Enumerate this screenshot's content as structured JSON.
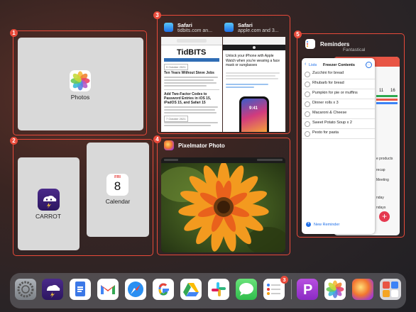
{
  "cards": {
    "photos": {
      "number": "1",
      "label": "Photos",
      "icon": "photos-icon"
    },
    "carrot_calendar": {
      "number": "2",
      "carrot_label": "CARROT",
      "calendar_label": "Calendar",
      "calendar_day": "FRI",
      "calendar_date": "8"
    },
    "safari": {
      "number": "3",
      "left": {
        "title": "Safari",
        "subtitle": "tidbits.com an..."
      },
      "right": {
        "title": "Safari",
        "subtitle": "apple.com and 3..."
      },
      "tidbits": {
        "site_name": "TidBITS",
        "date1": "9 October 2021",
        "headline1": "Ten Years Without Steve Jobs",
        "headline2": "Add Two-Factor Codes to Password Entries in iOS 15, iPadOS 15, and Safari 15",
        "date2": "7 October 2021"
      },
      "apple": {
        "headline": "Unlock your iPhone with Apple Watch when you're wearing a face mask or sunglasses"
      }
    },
    "pixelmator": {
      "number": "4",
      "title": "Pixelmator Photo"
    },
    "reminders": {
      "number": "5",
      "title": "Reminders",
      "behind_app": "Fantastical",
      "back_label": "Lists",
      "list_title": "Freezer Contents",
      "items": [
        "Zucchini for bread",
        "Rhubarb for bread",
        "Pumpkin for pie or muffins",
        "Dinner rolls x 3",
        "Macaroni & Cheese",
        "Sweet Potato Soup x 2",
        "Pesto for pasta"
      ],
      "new_reminder": "New Reminder",
      "behind_texts": [
        "11",
        "16",
        "recap",
        "e products",
        "Meeting",
        "nday",
        "ndays"
      ]
    }
  },
  "dock": {
    "badge": "3",
    "apps": [
      "settings-icon",
      "carrot-weather-icon",
      "google-docs-icon",
      "gmail-icon",
      "safari-icon",
      "google-icon",
      "google-drive-icon",
      "slack-icon",
      "messages-icon",
      "reminders-icon",
      "pcalc-icon",
      "photos-icon",
      "pixelmator-icon",
      "shortcuts-icon"
    ]
  },
  "colors": {
    "highlight": "#e84a3a"
  }
}
